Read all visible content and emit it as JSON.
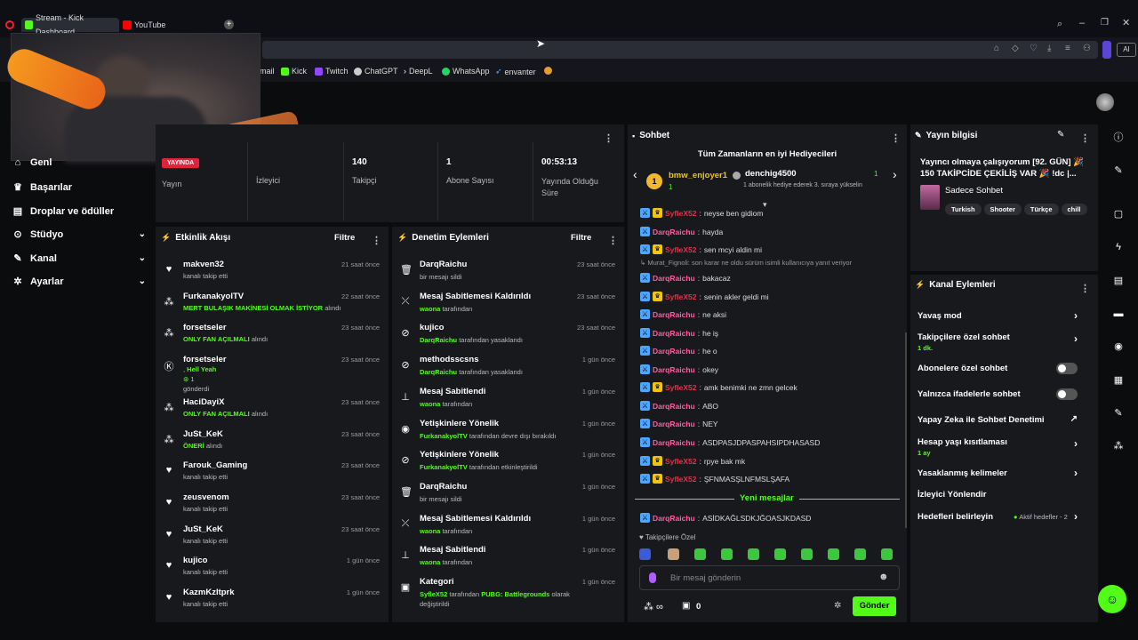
{
  "browser": {
    "tabs": [
      {
        "label": "Stream - Kick Dashboard"
      },
      {
        "label": "YouTube"
      }
    ],
    "ai_label": "AI",
    "bookmarks": [
      "mail",
      "Kick",
      "Twitch",
      "ChatGPT",
      "DeepL",
      "WhatsApp",
      "envanter"
    ]
  },
  "sidebar": {
    "items": [
      {
        "label": "Genl"
      },
      {
        "label": "Başarılar"
      },
      {
        "label": "Droplar ve ödüller"
      },
      {
        "label": "Stüdyo"
      },
      {
        "label": "Kanal"
      },
      {
        "label": "Ayarlar"
      }
    ]
  },
  "stats": {
    "live_badge": "YAYINDA",
    "stream_label": "Yayın",
    "viewers_label": "İzleyici",
    "followers_value": "140",
    "followers_label": "Takipçi",
    "subs_value": "1",
    "subs_label": "Abone Sayısı",
    "uptime_value": "00:53:13",
    "uptime_label": "Yayında Olduğu Süre"
  },
  "activity": {
    "title": "Etkinlik Akışı",
    "filter": "Filtre",
    "events": [
      {
        "name": "makven32",
        "desc": "kanalı takip etti",
        "highlight": "",
        "time": "21 saat önce"
      },
      {
        "name": "FurkanakyolTV",
        "desc": "alındı",
        "highlight": "MERT BULAŞIK MAKİNESİ OLMAK İSTİYOR",
        "time": "22 saat önce"
      },
      {
        "name": "forsetseler",
        "desc": "alındı",
        "highlight": "ONLY FAN AÇILMALI",
        "time": "23 saat önce"
      },
      {
        "name": "forsetseler",
        "desc": "gönderdi",
        "highlight": "Hell Yeah",
        "time": "23 saat önce"
      },
      {
        "name": "HaciDayiX",
        "desc": "alındı",
        "highlight": "ONLY FAN AÇILMALI",
        "time": "23 saat önce"
      },
      {
        "name": "JuSt_KeK",
        "desc": "alındı",
        "highlight": "ÖNERİ",
        "time": "23 saat önce"
      },
      {
        "name": "Farouk_Gaming",
        "desc": "kanalı takip etti",
        "highlight": "",
        "time": "23 saat önce"
      },
      {
        "name": "zeusvenom",
        "desc": "kanalı takip etti",
        "highlight": "",
        "time": "23 saat önce"
      },
      {
        "name": "JuSt_KeK",
        "desc": "kanalı takip etti",
        "highlight": "",
        "time": "23 saat önce"
      },
      {
        "name": "kujico",
        "desc": "kanalı takip etti",
        "highlight": "",
        "time": "1 gün önce"
      },
      {
        "name": "KazmKzltprk",
        "desc": "kanalı takip etti",
        "highlight": "",
        "time": "1 gün önce"
      }
    ],
    "gift_count": "1"
  },
  "moderation": {
    "title": "Denetim Eylemleri",
    "filter": "Filtre",
    "events": [
      {
        "name": "DarqRaichu",
        "by": "",
        "desc": "bir mesajı sildi",
        "time": "23 saat önce"
      },
      {
        "name": "Mesaj Sabitlemesi Kaldırıldı",
        "by": "waona",
        "desc": "tarafından",
        "time": "23 saat önce"
      },
      {
        "name": "kujico",
        "by": "DarqRaichu",
        "desc": "tarafından yasaklandı",
        "time": "23 saat önce"
      },
      {
        "name": "methodsscsns",
        "by": "DarqRaichu",
        "desc": "tarafından yasaklandı",
        "time": "1 gün önce"
      },
      {
        "name": "Mesaj Sabitlendi",
        "by": "waona",
        "desc": "tarafından",
        "time": "1 gün önce"
      },
      {
        "name": "Yetişkinlere Yönelik",
        "by": "FurkanakyolTV",
        "desc": "tarafından devre dışı bırakıldı",
        "time": "1 gün önce"
      },
      {
        "name": "Yetişkinlere Yönelik",
        "by": "FurkanakyolTV",
        "desc": "tarafından etkinleştirildi",
        "time": "1 gün önce"
      },
      {
        "name": "DarqRaichu",
        "by": "",
        "desc": "bir mesajı sildi",
        "time": "1 gün önce"
      },
      {
        "name": "Mesaj Sabitlemesi Kaldırıldı",
        "by": "waona",
        "desc": "tarafından",
        "time": "1 gün önce"
      },
      {
        "name": "Mesaj Sabitlendi",
        "by": "waona",
        "desc": "tarafından",
        "time": "1 gün önce"
      },
      {
        "name": "Kategori",
        "by": "SyfleX52",
        "desc": "tarafından",
        "time": "1 gün önce"
      }
    ],
    "category_game": "PUBG: Battlegrounds",
    "category_suffix": "olarak",
    "category_line2": "değiştirildi"
  },
  "chat": {
    "title": "Sohbet",
    "gifters_title": "Tüm Zamanların en iyi Hediyecileri",
    "gifter1_name": "bmw_enjoyer1",
    "gifter1_count": "1",
    "gifter2_name": "denchig4500",
    "gifter2_desc": "1 abonelik hediye ederek 3. sıraya yükselin",
    "gifter2_count": "1",
    "messages": [
      {
        "user": "SyfleX52",
        "text": "neyse ben gidiom",
        "mod": false
      },
      {
        "user": "DarqRaichu",
        "text": "hayda",
        "mod": true
      },
      {
        "user": "SyfleX52",
        "text": "sen mcyi aldin mi",
        "mod": false
      },
      {
        "user": "DarqRaichu",
        "text": "bakacaz",
        "mod": true
      },
      {
        "user": "SyfleX52",
        "text": "senin akler geldi mi",
        "mod": false
      },
      {
        "user": "DarqRaichu",
        "text": "ne aksi",
        "mod": true
      },
      {
        "user": "DarqRaichu",
        "text": "he iş",
        "mod": true
      },
      {
        "user": "DarqRaichu",
        "text": "he o",
        "mod": true
      },
      {
        "user": "DarqRaichu",
        "text": "okey",
        "mod": true
      },
      {
        "user": "SyfleX52",
        "text": "amk benimki ne zmn gelcek",
        "mod": false
      },
      {
        "user": "DarqRaichu",
        "text": "ABO",
        "mod": true
      },
      {
        "user": "DarqRaichu",
        "text": "NEY",
        "mod": true
      },
      {
        "user": "DarqRaichu",
        "text": "ASDPASJDPASPAHSIPDHASASD",
        "mod": true
      },
      {
        "user": "SyfleX52",
        "text": "rpye bak mk",
        "mod": false
      },
      {
        "user": "SyfleX52",
        "text": "ŞFNMASŞLNFMSLŞAFA",
        "mod": false
      }
    ],
    "reply_note": "Murat_Fignoli: son karar ne oldu sürüm isimli kullanıcıya yanıt veriyor",
    "new_messages": "Yeni mesajlar",
    "last_message_user": "DarqRaichu",
    "last_message_text": "ASİDKAĞLSDKJĞOASJKDASD",
    "followers_only": "Takipçilere Özel",
    "input_placeholder": "Bir mesaj gönderin",
    "points": "0",
    "send": "Gönder"
  },
  "stream_info": {
    "title": "Yayın bilgisi",
    "stream_title": "Yayıncı olmaya çalışıyorum [92. GÜN] 🎉 150 TAKİPCİDE ÇEKİLİŞ VAR 🎉 !dc |...",
    "category": "Sadece Sohbet",
    "tags": [
      "Turkish",
      "Shooter",
      "Türkçe",
      "chill"
    ]
  },
  "channel_actions": {
    "title": "Kanal Eylemleri",
    "slow_mode": "Yavaş mod",
    "followers_chat": "Takipçilere özel sohbet",
    "followers_chat_value": "1 dk.",
    "subs_chat": "Abonelere özel sohbet",
    "emotes_chat": "Yalnızca ifadelerle sohbet",
    "ai_moderation": "Yapay Zeka ile Sohbet Denetimi",
    "age_restriction": "Hesap yaşı kısıtlaması",
    "age_restriction_value": "1 ay",
    "banned_words": "Yasaklanmış kelimeler",
    "redirect": "İzleyici Yönlendir",
    "goals": "Hedefleri belirleyin",
    "goals_status": "Aktif hedefler - 2"
  },
  "colors": {
    "accent": "#53fc18",
    "panel": "#18191d",
    "mod_name": "#ff5fa2",
    "sub_name": "#e0334a"
  }
}
